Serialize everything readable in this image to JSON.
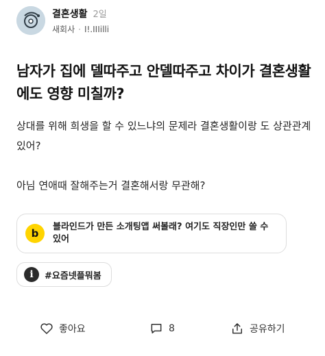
{
  "post": {
    "community": "결혼생활",
    "time": "2일",
    "author_company": "새회사",
    "author_name": "I!.IIIilli",
    "title": "남자가 집에 델따주고 안델따주고 차이가 결혼생활에도 영향 미칠까?",
    "body_line1": "상대를 위해 희생을 할 수 있느냐의 문제라 결혼생활이랑 도 상관관계 있어?",
    "body_line2": "아님 연애때 잘해주는거 결혼해서랑 무관해?"
  },
  "promo": {
    "icon_letter": "b",
    "text": "블라인드가 만든 소개팅앱 써볼래? 여기도 직장인만 쓸 수 있어"
  },
  "hashtag": {
    "icon_letter": "i",
    "label": "#요즘넷플뭐봄"
  },
  "actions": {
    "like_label": "좋아요",
    "comment_count": "8",
    "share_label": "공유하기"
  },
  "colors": {
    "avatar_bg": "#c9d8e2",
    "promo_icon": "#ffd400",
    "chip_icon": "#2b2b2b",
    "border": "#dcdcdc"
  },
  "icons": {
    "like": "heart-icon",
    "comment": "comment-icon",
    "share": "share-icon"
  }
}
